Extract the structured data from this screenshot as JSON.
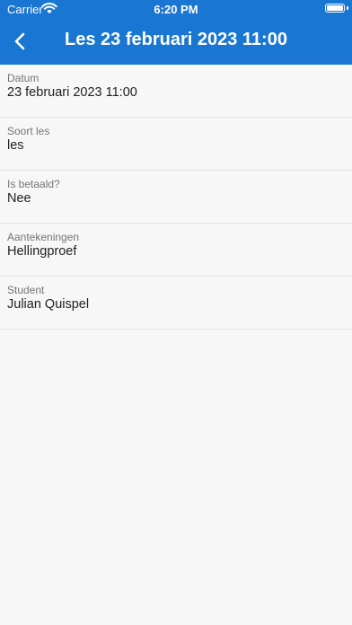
{
  "status_bar": {
    "carrier": "Carrier",
    "time": "6:20 PM"
  },
  "header": {
    "title": "Les 23 februari 2023 11:00",
    "back_icon": "chevron-left-icon",
    "background_color": "#1976d2"
  },
  "fields": [
    {
      "label": "Datum",
      "value": "23 februari 2023 11:00"
    },
    {
      "label": "Soort les",
      "value": "les"
    },
    {
      "label": "Is betaald?",
      "value": "Nee"
    },
    {
      "label": "Aantekeningen",
      "value": "Hellingproef"
    },
    {
      "label": "Student",
      "value": "Julian Quispel"
    }
  ]
}
